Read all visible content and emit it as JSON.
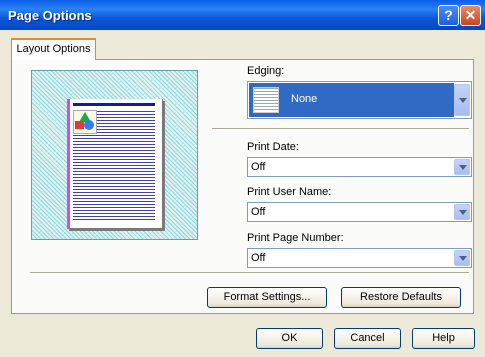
{
  "window": {
    "title": "Page Options",
    "help_glyph": "?",
    "close_glyph": "✕"
  },
  "tabs": [
    {
      "label": "Layout Options"
    }
  ],
  "edging": {
    "label": "Edging:",
    "value": "None"
  },
  "print_date": {
    "label": "Print Date:",
    "value": "Off"
  },
  "print_user_name": {
    "label": "Print User Name:",
    "value": "Off"
  },
  "print_page_number": {
    "label": "Print Page Number:",
    "value": "Off"
  },
  "buttons": {
    "format_settings": "Format Settings...",
    "restore_defaults": "Restore Defaults",
    "ok": "OK",
    "cancel": "Cancel",
    "help": "Help"
  },
  "colors": {
    "title_bar": "#0a5ee8",
    "selection": "#316ac5",
    "client_bg": "#ece9d8"
  }
}
